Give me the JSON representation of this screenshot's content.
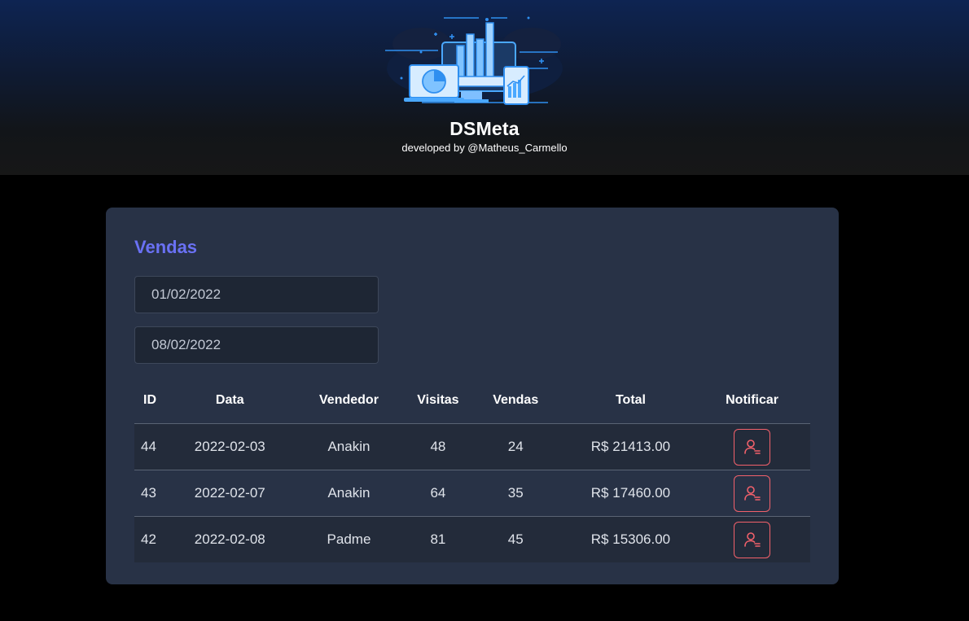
{
  "header": {
    "app_title": "DSMeta",
    "credit": "developed by @Matheus_Carmello"
  },
  "sales": {
    "title": "Vendas",
    "date_min": "01/02/2022",
    "date_max": "08/02/2022",
    "columns": [
      "ID",
      "Data",
      "Vendedor",
      "Visitas",
      "Vendas",
      "Total",
      "Notificar"
    ],
    "rows": [
      {
        "id": "44",
        "date": "2022-02-03",
        "seller": "Anakin",
        "visits": "48",
        "deals": "24",
        "total": "R$ 21413.00"
      },
      {
        "id": "43",
        "date": "2022-02-07",
        "seller": "Anakin",
        "visits": "64",
        "deals": "35",
        "total": "R$ 17460.00"
      },
      {
        "id": "42",
        "date": "2022-02-08",
        "seller": "Padme",
        "visits": "81",
        "deals": "45",
        "total": "R$ 15306.00"
      }
    ],
    "notify_icon": "user-notify-icon"
  },
  "colors": {
    "accent": "#6a71f4",
    "card_bg": "#283246",
    "notify": "#f2616b",
    "logo_blue": "#2f8ff0"
  }
}
